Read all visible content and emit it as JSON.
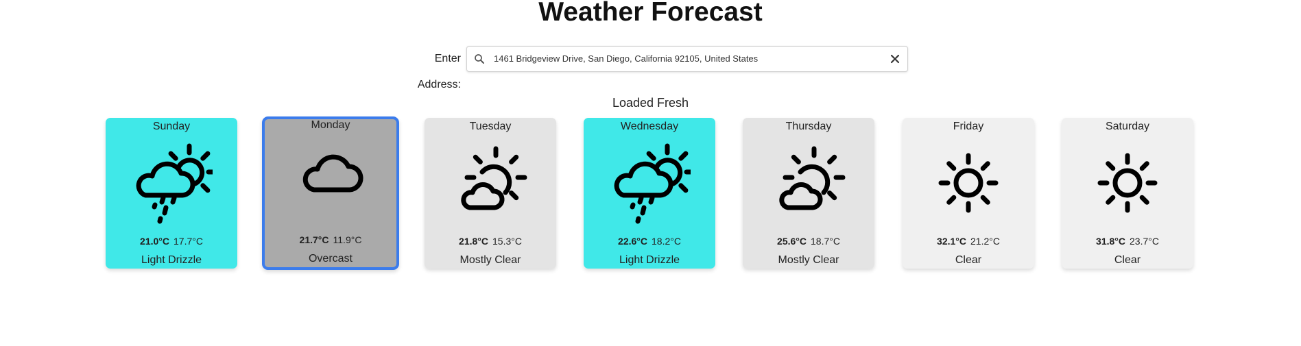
{
  "title": "Weather Forecast",
  "address": {
    "label": "Enter Address:",
    "value": "1461 Bridgeview Drive, San Diego, California 92105, United States",
    "search_icon": "search-icon",
    "clear_icon": "close-icon"
  },
  "status": "Loaded Fresh",
  "days": [
    {
      "day": "Sunday",
      "hi": "21.0°C",
      "lo": "17.7°C",
      "condition": "Light Drizzle",
      "icon": "drizzle-sun-icon",
      "bg": "#40e8e8",
      "selected": false
    },
    {
      "day": "Monday",
      "hi": "21.7°C",
      "lo": "11.9°C",
      "condition": "Overcast",
      "icon": "cloud-icon",
      "bg": "#aaaaaa",
      "selected": true
    },
    {
      "day": "Tuesday",
      "hi": "21.8°C",
      "lo": "15.3°C",
      "condition": "Mostly Clear",
      "icon": "sun-cloud-icon",
      "bg": "#e4e4e4",
      "selected": false
    },
    {
      "day": "Wednesday",
      "hi": "22.6°C",
      "lo": "18.2°C",
      "condition": "Light Drizzle",
      "icon": "drizzle-sun-icon",
      "bg": "#40e8e8",
      "selected": false
    },
    {
      "day": "Thursday",
      "hi": "25.6°C",
      "lo": "18.7°C",
      "condition": "Mostly Clear",
      "icon": "sun-cloud-icon",
      "bg": "#e4e4e4",
      "selected": false
    },
    {
      "day": "Friday",
      "hi": "32.1°C",
      "lo": "21.2°C",
      "condition": "Clear",
      "icon": "sun-icon",
      "bg": "#f0f0f0",
      "selected": false
    },
    {
      "day": "Saturday",
      "hi": "31.8°C",
      "lo": "23.7°C",
      "condition": "Clear",
      "icon": "sun-icon",
      "bg": "#f0f0f0",
      "selected": false
    }
  ]
}
